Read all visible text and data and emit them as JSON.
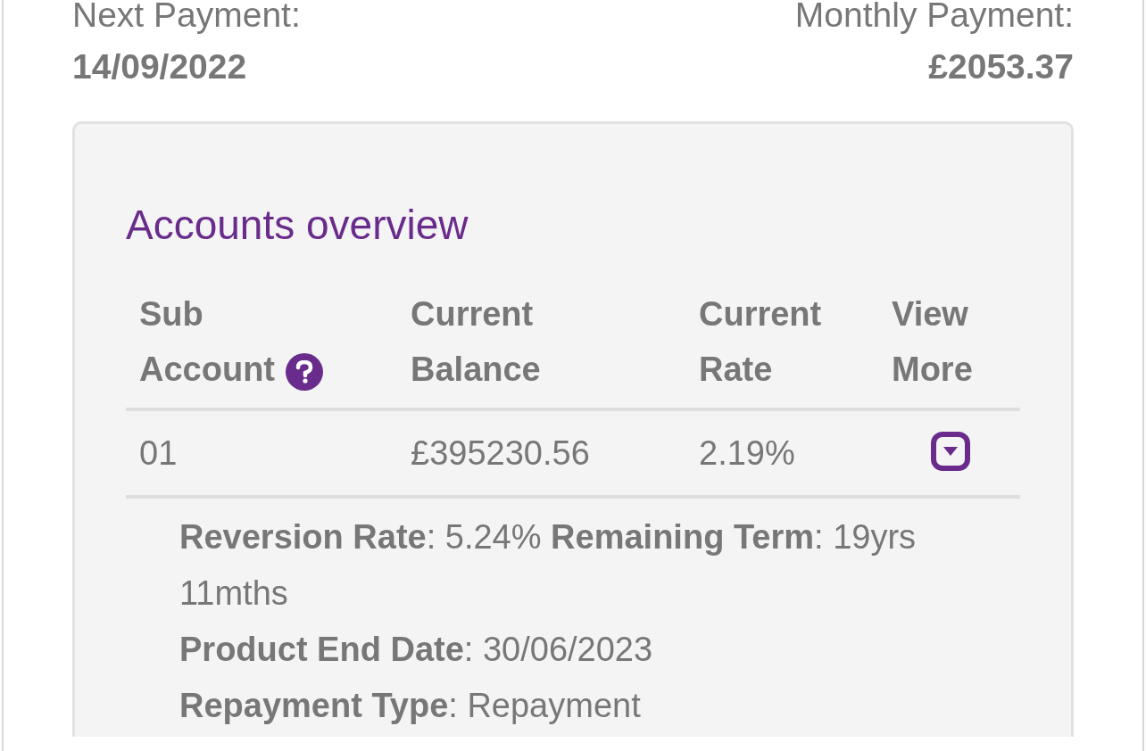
{
  "summary": [
    {
      "label": "Next Payment:",
      "value": "14/09/2022"
    },
    {
      "label": "Monthly Payment:",
      "value": "£2053.37"
    }
  ],
  "accounts": {
    "title": "Accounts overview",
    "columns": [
      {
        "lines": [
          "Sub",
          "Account"
        ],
        "help": true
      },
      {
        "lines": [
          "Current",
          "Balance"
        ],
        "help": false
      },
      {
        "lines": [
          "Current",
          "Rate"
        ],
        "help": false
      },
      {
        "lines": [
          "View",
          "More"
        ],
        "help": false
      }
    ],
    "rows": [
      {
        "sub_account": "01",
        "balance": "£395230.56",
        "rate": "2.19%",
        "expanded": true,
        "details": [
          "**Reversion Rate**: 5.24% **Remaining Term**: 19yrs 11mths",
          "**Product End Date**: 30/06/2023",
          "**Repayment Type**: Repayment"
        ]
      }
    ]
  }
}
